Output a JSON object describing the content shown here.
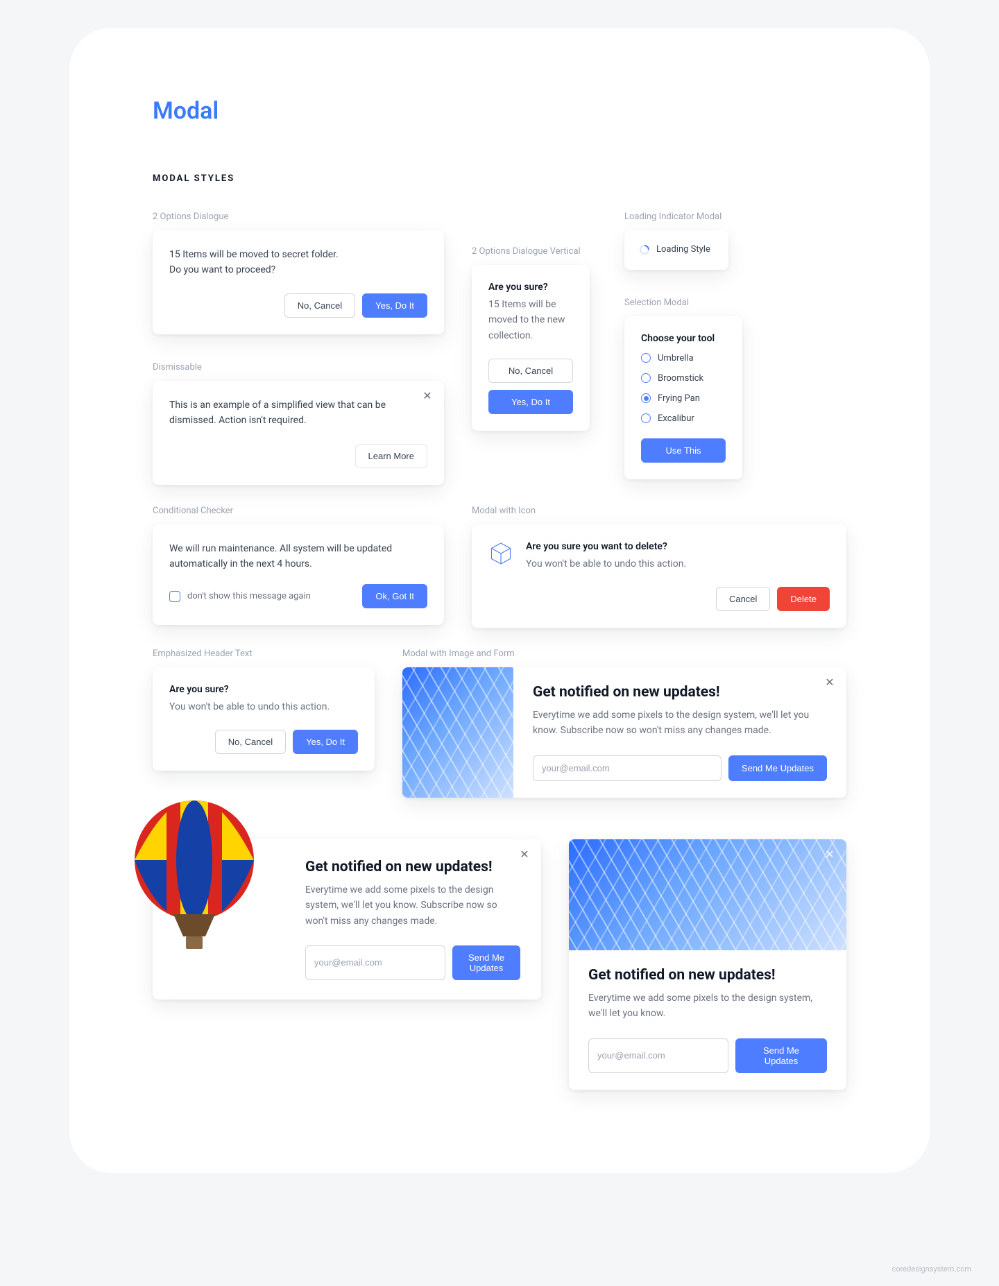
{
  "page": {
    "title": "Modal",
    "section": "MODAL STYLES"
  },
  "labels": {
    "twoOptions": "2 Options Dialogue",
    "twoOptionsVertical": "2 Options Dialogue Vertical",
    "loadingIndicator": "Loading Indicator Modal",
    "selectionModal": "Selection Modal",
    "dismissable": "Dismissable",
    "conditional": "Conditional Checker",
    "modalWithIcon": "Modal with Icon",
    "emphasizedHeader": "Emphasized Header Text",
    "modalImageForm": "Modal with Image and Form"
  },
  "twoOptions": {
    "line1": "15 Items will be moved to secret folder.",
    "line2": "Do you want to proceed?",
    "cancel": "No, Cancel",
    "confirm": "Yes, Do It"
  },
  "twoOptionsVertical": {
    "title": "Are you sure?",
    "body": "15 Items will be moved to the new collection.",
    "cancel": "No, Cancel",
    "confirm": "Yes, Do It"
  },
  "loading": {
    "text": "Loading Style"
  },
  "selection": {
    "title": "Choose your tool",
    "options": [
      "Umbrella",
      "Broomstick",
      "Frying Pan",
      "Excalibur"
    ],
    "selectedIndex": 2,
    "use": "Use This"
  },
  "dismissable": {
    "body": "This is an example of a simplified view that can be dismissed. Action isn't required.",
    "learn": "Learn More"
  },
  "conditional": {
    "body": "We will run maintenance. All system will be updated automatically in the next 4 hours.",
    "checkbox": "don't show this message again",
    "ok": "Ok, Got It"
  },
  "iconModal": {
    "title": "Are you sure you want to delete?",
    "body": "You won't be able to undo this action.",
    "cancel": "Cancel",
    "delete": "Delete"
  },
  "emphasized": {
    "title": "Are you sure?",
    "body": "You won't be able to undo this action.",
    "cancel": "No, Cancel",
    "confirm": "Yes, Do It"
  },
  "subscribe1": {
    "title": "Get notified on new updates!",
    "body": "Everytime we add some pixels to the design system, we'll let you know. Subscribe now so won't miss any changes made.",
    "placeholder": "your@email.com",
    "cta": "Send Me Updates"
  },
  "subscribe2": {
    "title": "Get notified on new updates!",
    "body": "Everytime we add some pixels to the design system, we'll let you know. Subscribe now so won't miss any changes made.",
    "placeholder": "your@email.com",
    "cta": "Send Me Updates"
  },
  "subscribe3": {
    "title": "Get notified on new updates!",
    "body": "Everytime we add some pixels to the design system, we'll let you know.",
    "placeholder": "your@email.com",
    "cta": "Send Me Updates"
  },
  "footer": "coredesignsystem.com"
}
